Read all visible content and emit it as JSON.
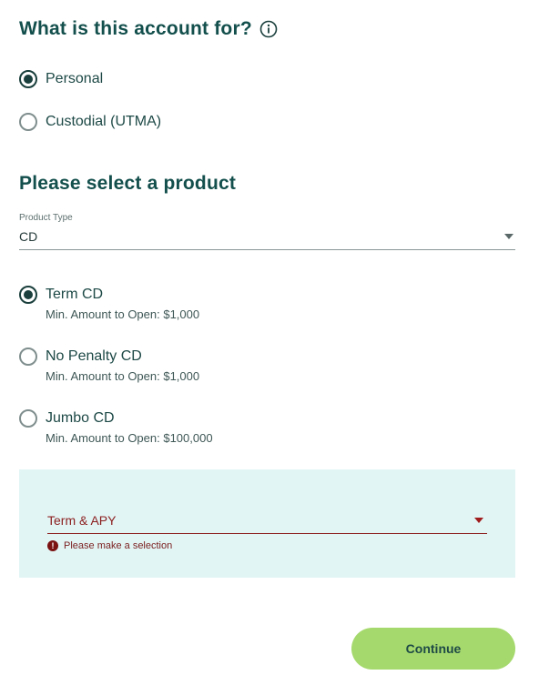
{
  "account": {
    "heading": "What is this account for?",
    "options": [
      {
        "label": "Personal",
        "checked": true
      },
      {
        "label": "Custodial (UTMA)",
        "checked": false
      }
    ]
  },
  "product": {
    "heading": "Please select a product",
    "type_label": "Product Type",
    "type_value": "CD",
    "options": [
      {
        "label": "Term CD",
        "min": "Min. Amount to Open: $1,000",
        "checked": true
      },
      {
        "label": "No Penalty CD",
        "min": "Min. Amount to Open: $1,000",
        "checked": false
      },
      {
        "label": "Jumbo CD",
        "min": "Min. Amount to Open: $100,000",
        "checked": false
      }
    ]
  },
  "term": {
    "placeholder": "Term & APY",
    "error": "Please make a selection",
    "error_icon": "!"
  },
  "actions": {
    "continue_label": "Continue"
  },
  "colors": {
    "heading": "#134f4c",
    "panel_bg": "#e2f5f5",
    "error": "#8c1d1d",
    "button_bg": "#a5d96d"
  }
}
